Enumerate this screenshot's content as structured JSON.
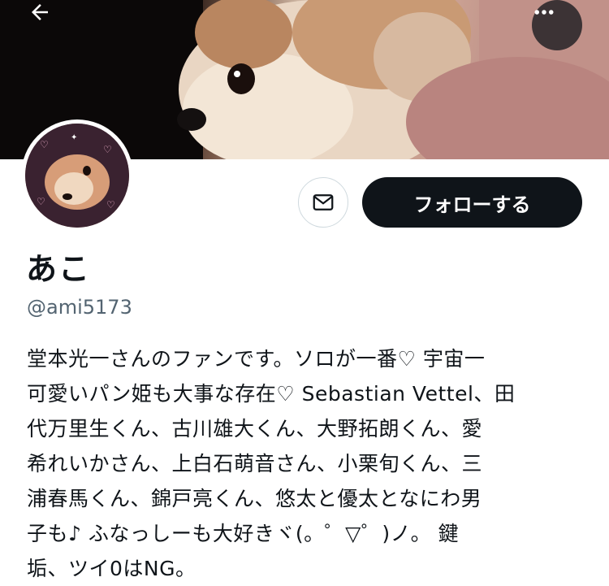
{
  "header": {
    "back_icon": "arrow-left-icon",
    "more_icon": "more-horizontal-icon"
  },
  "profile": {
    "display_name": "あこ",
    "handle": "@ami5173",
    "message_icon": "mail-icon",
    "follow_label": "フォローする",
    "bio_lines": [
      "堂本光一さんのファンです。ソロが一番♡ 宇宙一",
      "可愛いパン姫も大事な存在♡ Sebastian Vettel、田",
      "代万里生くん、古川雄大くん、大野拓朗くん、愛",
      "希れいかさん、上白石萌音さん、小栗旬くん、三",
      "浦春馬くん、錦戸亮くん、悠太と優太となにわ男",
      "子も♪ ふなっしーも大好きヾ(。゜▽゜)ノ。 鍵",
      "垢、ツイ0はNG。"
    ]
  },
  "colors": {
    "text": "#0f1419",
    "secondary": "#536471",
    "button_bg": "#0f1419",
    "border": "#cfd9de"
  }
}
